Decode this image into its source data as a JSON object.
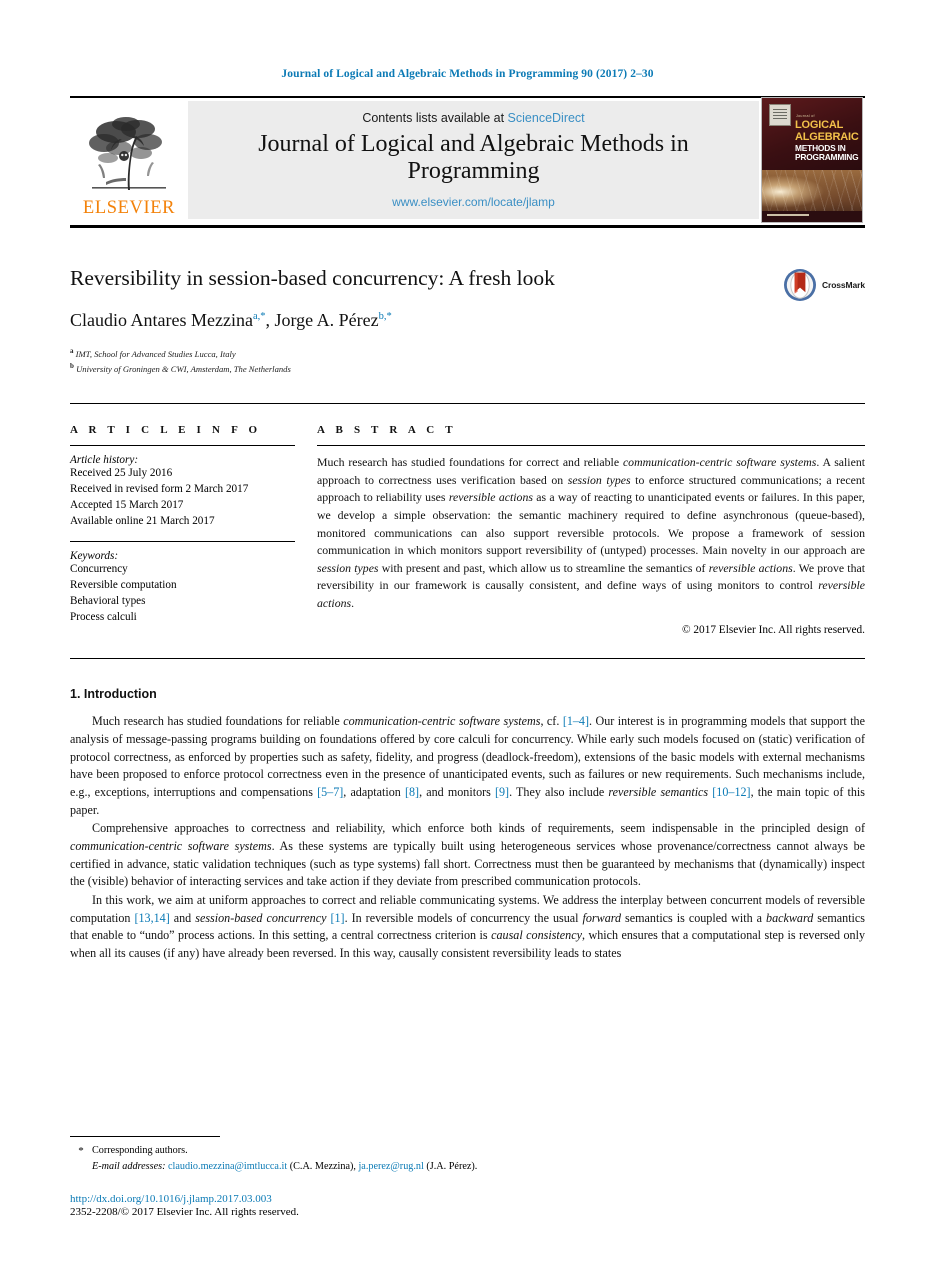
{
  "running_head": "Journal of Logical and Algebraic Methods in Programming 90 (2017) 2–30",
  "masthead": {
    "publisher_name": "ELSEVIER",
    "contents_prefix": "Contents lists available at ",
    "contents_link": "ScienceDirect",
    "journal_title": "Journal of Logical and Algebraic Methods in Programming",
    "journal_url": "www.elsevier.com/locate/jlamp",
    "cover": {
      "kicker": "Journal of",
      "line1": "LOGICAL",
      "line2": "ALGEBRAIC",
      "line3": "METHODS IN",
      "line4": "PROGRAMMING"
    }
  },
  "article": {
    "title": "Reversibility in session-based concurrency: A fresh look",
    "crossmark_label": "CrossMark",
    "authors": [
      {
        "name": "Claudio Antares Mezzina",
        "marks": "a,*"
      },
      {
        "name": "Jorge A. Pérez",
        "marks": "b,*"
      }
    ],
    "affiliations": [
      {
        "mark": "a",
        "text": "IMT, School for Advanced Studies Lucca, Italy"
      },
      {
        "mark": "b",
        "text": "University of Groningen & CWI, Amsterdam, The Netherlands"
      }
    ]
  },
  "info": {
    "heading": "A R T I C L E   I N F O",
    "history_label": "Article history:",
    "history": [
      "Received 25 July 2016",
      "Received in revised form 2 March 2017",
      "Accepted 15 March 2017",
      "Available online 21 March 2017"
    ],
    "keywords_label": "Keywords:",
    "keywords": [
      "Concurrency",
      "Reversible computation",
      "Behavioral types",
      "Process calculi"
    ]
  },
  "abstract": {
    "heading": "A B S T R A C T",
    "text": "Much research has studied foundations for correct and reliable communication-centric software systems. A salient approach to correctness uses verification based on session types to enforce structured communications; a recent approach to reliability uses reversible actions as a way of reacting to unanticipated events or failures. In this paper, we develop a simple observation: the semantic machinery required to define asynchronous (queue-based), monitored communications can also support reversible protocols. We propose a framework of session communication in which monitors support reversibility of (untyped) processes. Main novelty in our approach are session types with present and past, which allow us to streamline the semantics of reversible actions. We prove that reversibility in our framework is causally consistent, and define ways of using monitors to control reversible actions.",
    "copyright": "© 2017 Elsevier Inc. All rights reserved."
  },
  "body": {
    "section_number_title": "1. Introduction",
    "paragraph_1": "Much research has studied foundations for reliable communication-centric software systems, cf. [1–4]. Our interest is in programming models that support the analysis of message-passing programs building on foundations offered by core calculi for concurrency. While early such models focused on (static) verification of protocol correctness, as enforced by properties such as safety, fidelity, and progress (deadlock-freedom), extensions of the basic models with external mechanisms have been proposed to enforce protocol correctness even in the presence of unanticipated events, such as failures or new requirements. Such mechanisms include, e.g., exceptions, interruptions and compensations [5–7], adaptation [8], and monitors [9]. They also include reversible semantics [10–12], the main topic of this paper.",
    "paragraph_2": "Comprehensive approaches to correctness and reliability, which enforce both kinds of requirements, seem indispensable in the principled design of communication-centric software systems. As these systems are typically built using heterogeneous services whose provenance/correctness cannot always be certified in advance, static validation techniques (such as type systems) fall short. Correctness must then be guaranteed by mechanisms that (dynamically) inspect the (visible) behavior of interacting services and take action if they deviate from prescribed communication protocols.",
    "paragraph_3": "In this work, we aim at uniform approaches to correct and reliable communicating systems. We address the interplay between concurrent models of reversible computation [13,14] and session-based concurrency [1]. In reversible models of concurrency the usual forward semantics is coupled with a backward semantics that enable to “undo” process actions. In this setting, a central correctness criterion is causal consistency, which ensures that a computational step is reversed only when all its causes (if any) have already been reversed. In this way, causally consistent reversibility leads to states"
  },
  "footer": {
    "corresponding_star": "*",
    "corresponding_label": "Corresponding authors.",
    "email_label": "E-mail addresses:",
    "email_1": "claudio.mezzina@imtlucca.it",
    "email_1_owner": "(C.A. Mezzina),",
    "email_2": "ja.perez@rug.nl",
    "email_2_owner": "(J.A. Pérez).",
    "doi": "http://dx.doi.org/10.1016/j.jlamp.2017.03.003",
    "issn_line": "2352-2208/© 2017 Elsevier Inc. All rights reserved."
  },
  "colors": {
    "link_blue": "#0b7ab5",
    "sciencedirect_blue": "#3a8fc4",
    "elsevier_orange": "#f3820a",
    "masthead_gray": "#ececec"
  }
}
